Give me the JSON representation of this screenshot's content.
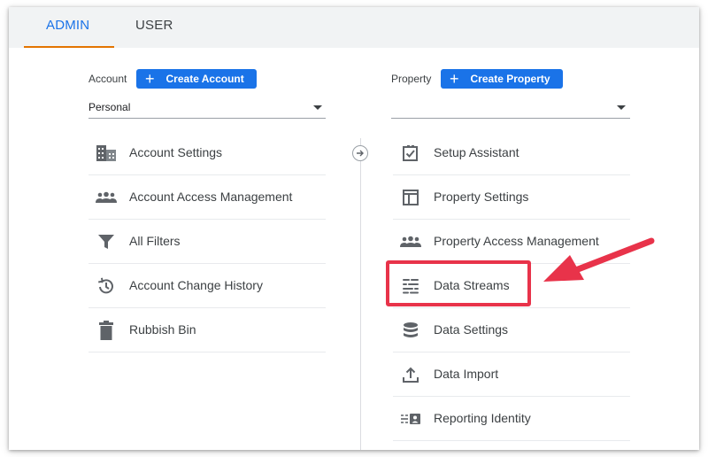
{
  "tabs": [
    {
      "label": "ADMIN",
      "active": true
    },
    {
      "label": "USER",
      "active": false
    }
  ],
  "account": {
    "label": "Account",
    "create_button": "Create Account",
    "selected": "Personal",
    "items": [
      {
        "label": "Account Settings",
        "icon": "building-icon"
      },
      {
        "label": "Account Access Management",
        "icon": "people-icon"
      },
      {
        "label": "All Filters",
        "icon": "filter-icon"
      },
      {
        "label": "Account Change History",
        "icon": "history-icon"
      },
      {
        "label": "Rubbish Bin",
        "icon": "trash-icon"
      }
    ]
  },
  "property": {
    "label": "Property",
    "create_button": "Create Property",
    "selected": "",
    "items": [
      {
        "label": "Setup Assistant",
        "icon": "checkbox-icon"
      },
      {
        "label": "Property Settings",
        "icon": "layout-icon"
      },
      {
        "label": "Property Access Management",
        "icon": "people-icon"
      },
      {
        "label": "Data Streams",
        "icon": "streams-icon",
        "highlighted": true
      },
      {
        "label": "Data Settings",
        "icon": "database-icon"
      },
      {
        "label": "Data Import",
        "icon": "upload-icon"
      },
      {
        "label": "Reporting Identity",
        "icon": "identity-icon"
      }
    ]
  },
  "colors": {
    "accent": "#1a73e8",
    "tab_underline": "#e37400",
    "annotation": "#e8334a"
  }
}
